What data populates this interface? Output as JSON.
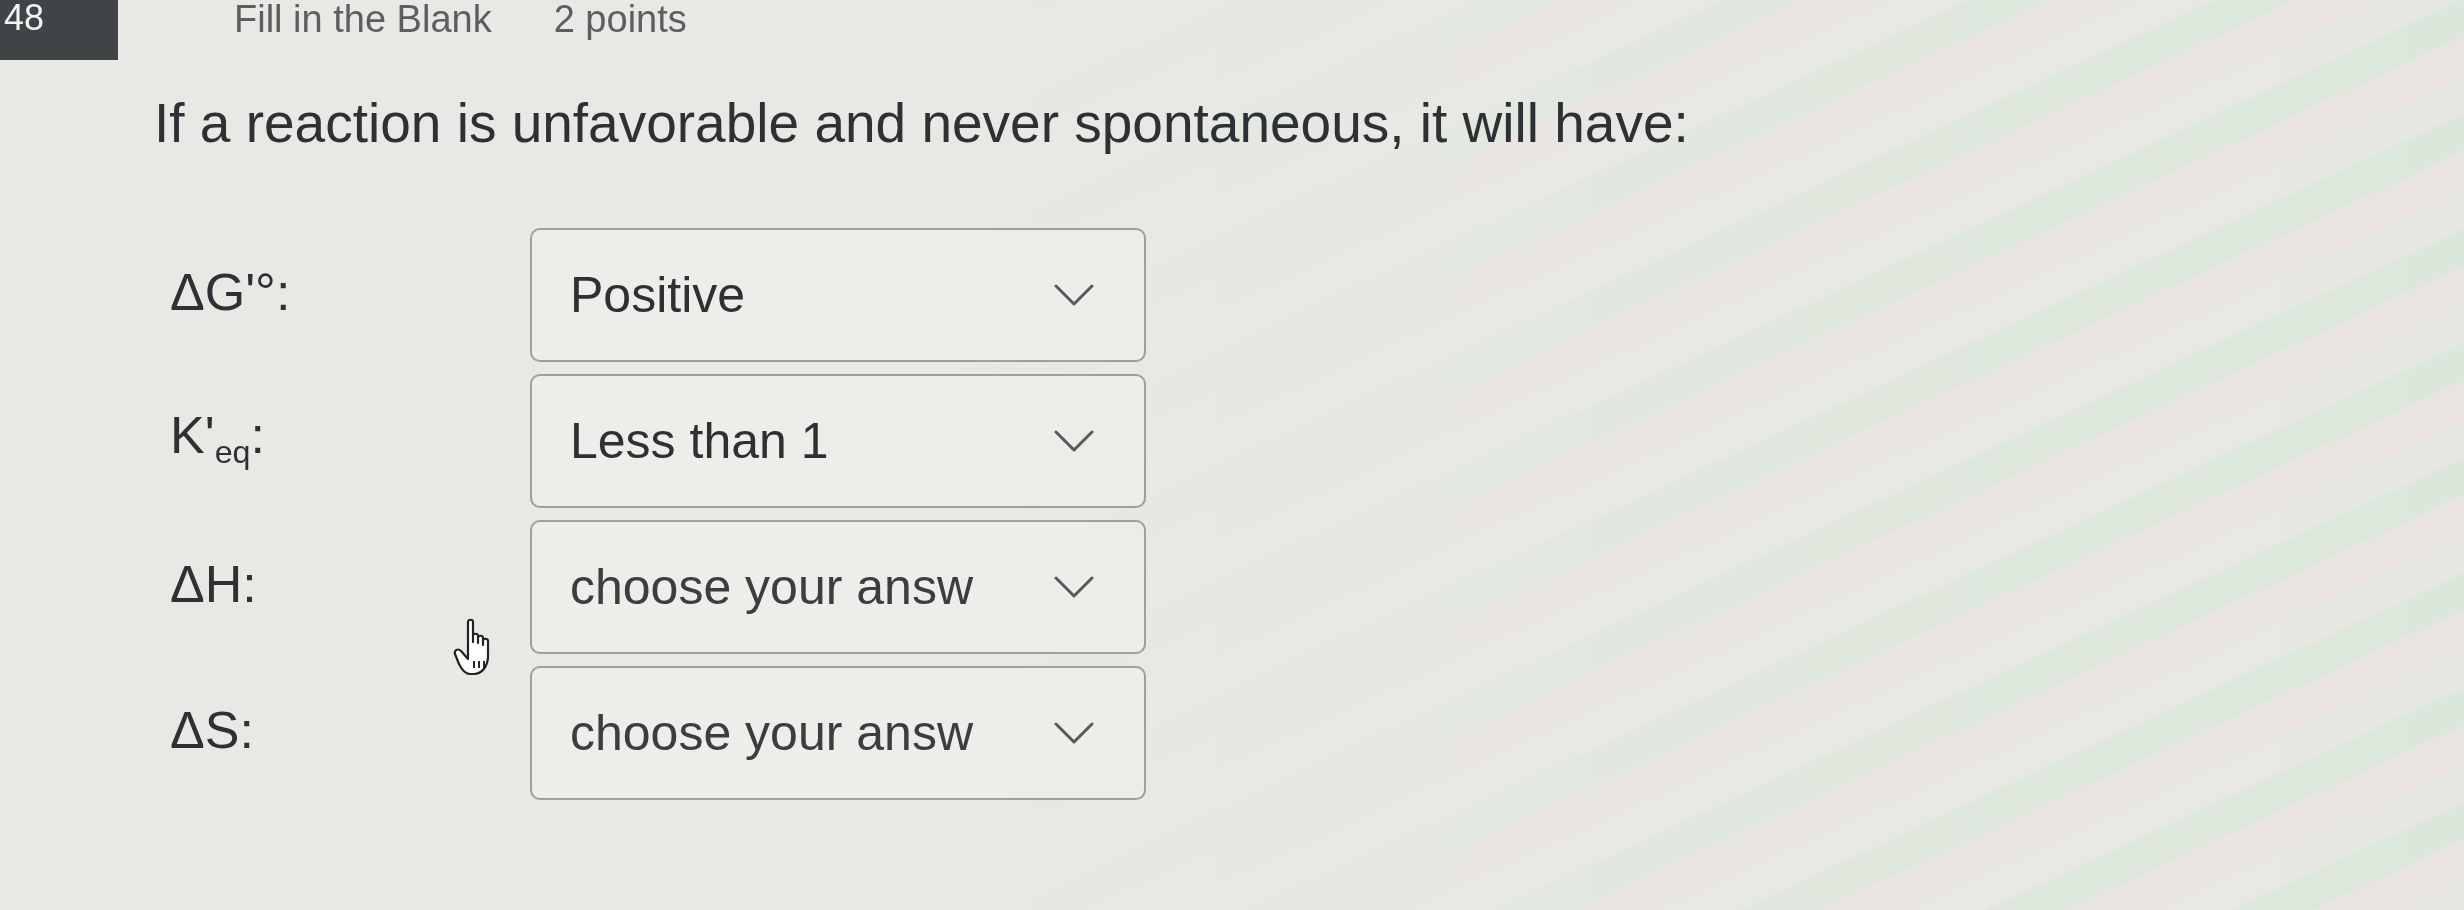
{
  "question_header": {
    "number": "48",
    "type": "Fill in the Blank",
    "points": "2 points"
  },
  "question": {
    "prompt": "If a reaction is unfavorable and never spontaneous, it will have:",
    "blanks": [
      {
        "label": "ΔG'°:",
        "value": "Positive"
      },
      {
        "label": "K'$_{eq}$:",
        "value": "Less than 1"
      },
      {
        "label": "ΔH:",
        "placeholder": "choose your answ"
      },
      {
        "label": "ΔS:",
        "placeholder": "choose your answ"
      }
    ]
  }
}
